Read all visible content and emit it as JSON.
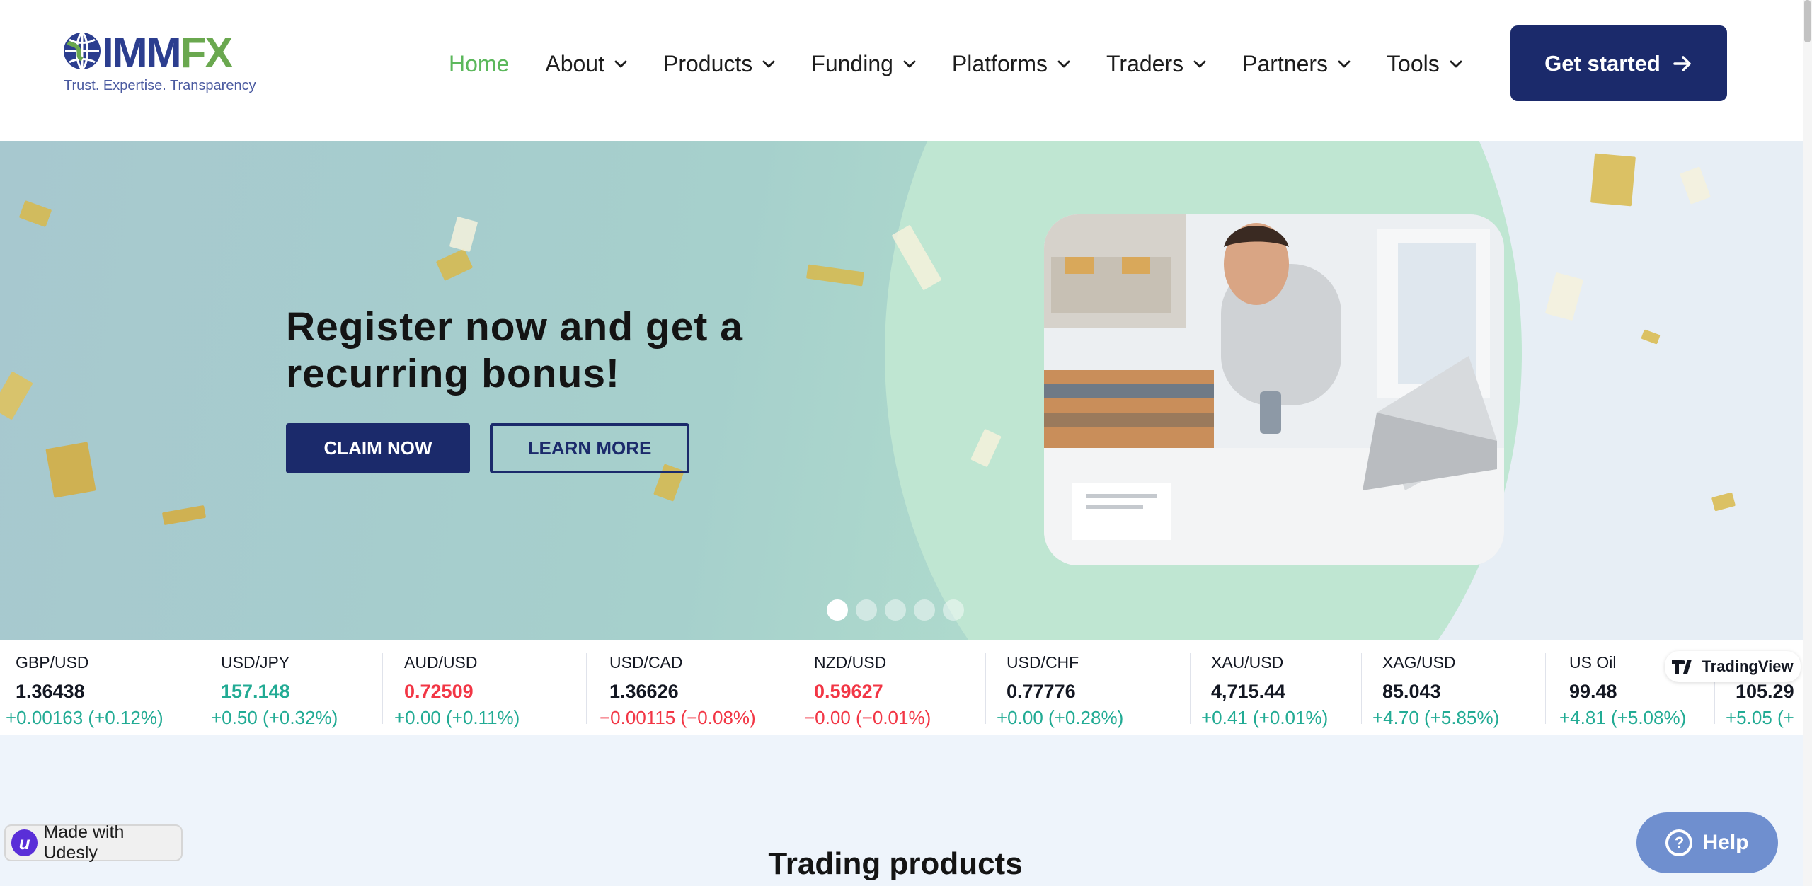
{
  "header": {
    "logo": {
      "brand_main": "IMM",
      "brand_accent": "FX",
      "tagline": "Trust. Expertise. Transparency"
    },
    "nav": [
      {
        "label": "Home",
        "active": true,
        "dropdown": false
      },
      {
        "label": "About",
        "active": false,
        "dropdown": true
      },
      {
        "label": "Products",
        "active": false,
        "dropdown": true
      },
      {
        "label": "Funding",
        "active": false,
        "dropdown": true
      },
      {
        "label": "Platforms",
        "active": false,
        "dropdown": true
      },
      {
        "label": "Traders",
        "active": false,
        "dropdown": true
      },
      {
        "label": "Partners",
        "active": false,
        "dropdown": true
      },
      {
        "label": "Tools",
        "active": false,
        "dropdown": true
      }
    ],
    "cta_label": "Get started"
  },
  "hero": {
    "title_line1": "Register now and get a",
    "title_strong": "recurring bonus",
    "title_punct": "!",
    "claim_label": "CLAIM NOW",
    "learn_label": "LEARN MORE",
    "slides": 5,
    "active_slide": 1
  },
  "ticker": [
    {
      "symbol": "GBP/USD",
      "price": "1.36438",
      "change": "+0.00163 (+0.12%)",
      "price_color": "neutral",
      "change_color": "up"
    },
    {
      "symbol": "USD/JPY",
      "price": "157.148",
      "change": "+0.50 (+0.32%)",
      "price_color": "up",
      "change_color": "up"
    },
    {
      "symbol": "AUD/USD",
      "price": "0.72509",
      "change": "+0.00 (+0.11%)",
      "price_color": "down",
      "change_color": "up"
    },
    {
      "symbol": "USD/CAD",
      "price": "1.36626",
      "change": "−0.00115 (−0.08%)",
      "price_color": "neutral",
      "change_color": "down"
    },
    {
      "symbol": "NZD/USD",
      "price": "0.59627",
      "change": "−0.00 (−0.01%)",
      "price_color": "down",
      "change_color": "down"
    },
    {
      "symbol": "USD/CHF",
      "price": "0.77776",
      "change": "+0.00 (+0.28%)",
      "price_color": "neutral",
      "change_color": "up"
    },
    {
      "symbol": "XAU/USD",
      "price": "4,715.44",
      "change": "+0.41 (+0.01%)",
      "price_color": "neutral",
      "change_color": "up"
    },
    {
      "symbol": "XAG/USD",
      "price": "85.043",
      "change": "+4.70 (+5.85%)",
      "price_color": "neutral",
      "change_color": "up"
    },
    {
      "symbol": "US Oil",
      "price": "99.48",
      "change": "+4.81 (+5.08%)",
      "price_color": "neutral",
      "change_color": "up"
    },
    {
      "symbol": "",
      "price": "105.29",
      "change": "+5.05 (+",
      "price_color": "neutral",
      "change_color": "up"
    }
  ],
  "tradingview_label": "TradingView",
  "section_title": "Trading products",
  "udesly_label": "Made with Udesly",
  "help_label": "Help",
  "colors": {
    "brand_navy": "#1b2a6b",
    "nav_active": "#5cb85c",
    "ticker_up": "#22ab94",
    "ticker_down": "#f23645"
  }
}
